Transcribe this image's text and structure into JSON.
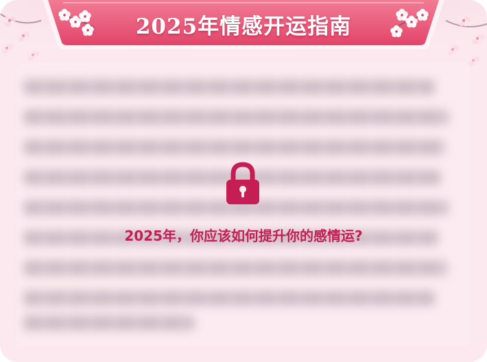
{
  "banner": {
    "title": "2025年情感开运指南"
  },
  "locked_content": {
    "prompt": "2025年，你应该如何提升你的感情运?"
  },
  "colors": {
    "banner_red": "#e8506f",
    "lock_red": "#c41e55",
    "card_pink": "#fbe9ef"
  },
  "icons": {
    "lock": "lock-icon",
    "blossom": "cherry-blossom-icon"
  }
}
